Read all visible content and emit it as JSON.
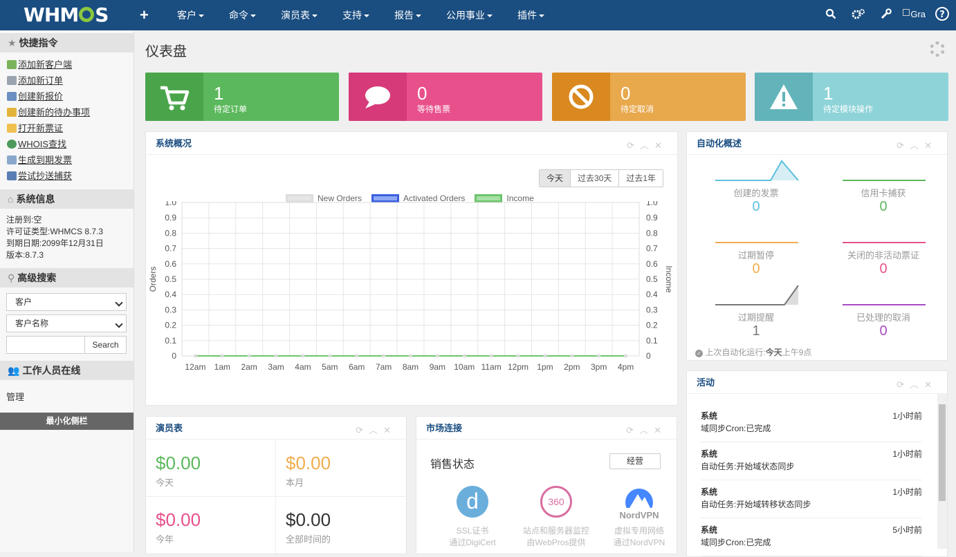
{
  "topbar": {
    "logo": "WHMCS",
    "nav": [
      "客户",
      "命令",
      "演员表",
      "支持",
      "报告",
      "公用事业",
      "插件"
    ],
    "avatar_alt": "Gra",
    "colors": {
      "bg": "#1a4d80"
    }
  },
  "sidebar": {
    "quick_title": "快捷指令",
    "quick_links": [
      "添加新客户端",
      "添加新订单",
      "创建新报价",
      "创建新的待办事项",
      "打开新票证",
      "WHOIS查找",
      "生成到期发票",
      "尝试抄送捕获"
    ],
    "sysinfo_title": "系统信息",
    "sysinfo": [
      "注册到:空",
      "许可证类型:WHMCS 8.7.3",
      "到期日期:2099年12月31日",
      "版本:8.7.3"
    ],
    "search_title": "高级搜索",
    "search_select1": "客户",
    "search_select2": "客户名称",
    "search_button": "Search",
    "staff_title": "工作人员在线",
    "staff_name": "管理",
    "minimize": "最小化侧栏"
  },
  "main": {
    "title": "仪表盘",
    "stats": [
      {
        "num": "1",
        "label": "待定订单",
        "color": "#5cb85c",
        "dark": "#4aa54a",
        "icon": "cart-icon"
      },
      {
        "num": "0",
        "label": "等待售票",
        "color": "#e8508c",
        "dark": "#d63a78",
        "icon": "chat-icon"
      },
      {
        "num": "0",
        "label": "待定取消",
        "color": "#e8a84c",
        "dark": "#d9891f",
        "icon": "ban-icon"
      },
      {
        "num": "1",
        "label": "待定模块操作",
        "color": "#8ed3d8",
        "dark": "#62b4ba",
        "icon": "warning-icon"
      }
    ],
    "overview": {
      "title": "系统概况",
      "ranges": [
        "今天",
        "过去30天",
        "过去1年"
      ],
      "legend": [
        "New Orders",
        "Activated Orders",
        "Income"
      ]
    },
    "automation": {
      "title": "自动化概述",
      "items": [
        {
          "label": "创建的发票",
          "value": "0",
          "color": "#5bc0de"
        },
        {
          "label": "信用卡捕获",
          "value": "0",
          "color": "#5cb85c"
        },
        {
          "label": "过期暂停",
          "value": "0",
          "color": "#f0ad4e"
        },
        {
          "label": "关闭的非活动票证",
          "value": "0",
          "color": "#e8508c"
        },
        {
          "label": "过期提醒",
          "value": "1",
          "color": "#777777"
        },
        {
          "label": "已处理的取消",
          "value": "0",
          "color": "#a84ac4"
        }
      ],
      "footer_prefix": "上次自动化运行:",
      "footer_today": "今天",
      "footer_time": "上午9点"
    },
    "activity": {
      "title": "活动",
      "items": [
        {
          "user": "系统",
          "time": "1小时前",
          "desc": "域同步Cron:已完成"
        },
        {
          "user": "系统",
          "time": "1小时前",
          "desc": "自动任务:开始域状态同步"
        },
        {
          "user": "系统",
          "time": "1小时前",
          "desc": "自动任务:开始域转移状态同步"
        },
        {
          "user": "系统",
          "time": "5小时前",
          "desc": "域同步Cron:已完成"
        }
      ]
    },
    "billing": {
      "title": "演员表",
      "items": [
        {
          "value": "$0.00",
          "label": "今天",
          "color": "#5cb85c"
        },
        {
          "value": "$0.00",
          "label": "本月",
          "color": "#f0ad4e"
        },
        {
          "value": "$0.00",
          "label": "今年",
          "color": "#e8508c"
        },
        {
          "value": "$0.00",
          "label": "全部时间的",
          "color": "#333333"
        }
      ]
    },
    "market": {
      "title": "市场连接",
      "subtitle": "销售状态",
      "button": "经营",
      "items": [
        {
          "line1": "SSL证书",
          "line2": "通过DigiCert"
        },
        {
          "line1": "站点和服务器监控",
          "line2": "由WebPros提供"
        },
        {
          "line1": "虚拟专用网络",
          "line2": "通过NordVPN"
        }
      ],
      "logos": [
        "d",
        "360",
        "NordVPN"
      ]
    }
  },
  "chart_data": {
    "type": "line",
    "x": [
      "12am",
      "1am",
      "2am",
      "3am",
      "4am",
      "5am",
      "6am",
      "7am",
      "8am",
      "9am",
      "10am",
      "11am",
      "12pm",
      "1pm",
      "2pm",
      "3pm",
      "4pm"
    ],
    "series": [
      {
        "name": "New Orders",
        "values": [
          0,
          0,
          0,
          0,
          0,
          0,
          0,
          0,
          0,
          0,
          0,
          0,
          0,
          0,
          0,
          0,
          0
        ]
      },
      {
        "name": "Activated Orders",
        "values": [
          0,
          0,
          0,
          0,
          0,
          0,
          0,
          0,
          0,
          0,
          0,
          0,
          0,
          0,
          0,
          0,
          0
        ]
      },
      {
        "name": "Income",
        "values": [
          0,
          0,
          0,
          0,
          0,
          0,
          0,
          0,
          0,
          0,
          0,
          0,
          0,
          0,
          0,
          0,
          0
        ]
      }
    ],
    "ylabel": "Orders",
    "y2label": "Income",
    "ylim": [
      0,
      1
    ],
    "yticks": [
      "0",
      "0.1",
      "0.2",
      "0.3",
      "0.4",
      "0.5",
      "0.6",
      "0.7",
      "0.8",
      "0.9",
      "1.0"
    ],
    "grid": true,
    "legend": "top"
  }
}
